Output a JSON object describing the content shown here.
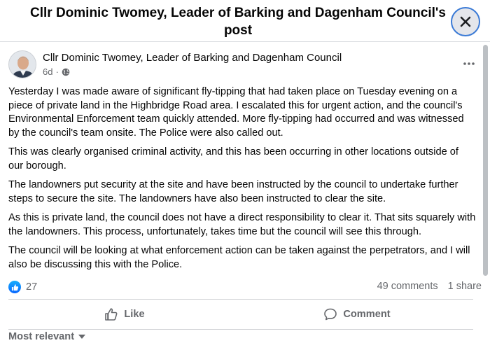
{
  "dialog": {
    "title": "Cllr Dominic Twomey, Leader of Barking and Dagenham Council's post"
  },
  "post": {
    "author": "Cllr Dominic Twomey, Leader of Barking and Dagenham Council",
    "time": "6d",
    "audience_icon": "globe-icon",
    "paragraphs": [
      "Yesterday I was made aware of significant fly-tipping that had taken place on Tuesday evening on a piece of private land in the Highbridge Road area. I escalated this for urgent action, and the council's Environmental Enforcement team quickly attended. More fly-tipping had occurred and was witnessed by the council's team onsite. The Police were also called out.",
      "This was clearly organised criminal activity, and this has been occurring in other locations outside of our borough.",
      "The landowners put security at the site and have been instructed by the council to undertake further steps to secure the site. The landowners have also been instructed to clear the site.",
      "As this is private land, the council does not have a direct responsibility to clear it. That sits squarely with the landowners. This  process, unfortunately, takes time but the council will see this through.",
      "The council will be looking at what enforcement action can be taken against the perpetrators, and I will also be discussing this with the Police."
    ]
  },
  "engagement": {
    "reaction_count": "27",
    "comments": "49 comments",
    "shares": "1 share"
  },
  "actions": {
    "like": "Like",
    "comment": "Comment"
  },
  "comments_sort": {
    "label": "Most relevant"
  },
  "colors": {
    "accent": "#0866ff",
    "muted_text": "#65676b",
    "close_button_bg": "#e4e6eb"
  }
}
